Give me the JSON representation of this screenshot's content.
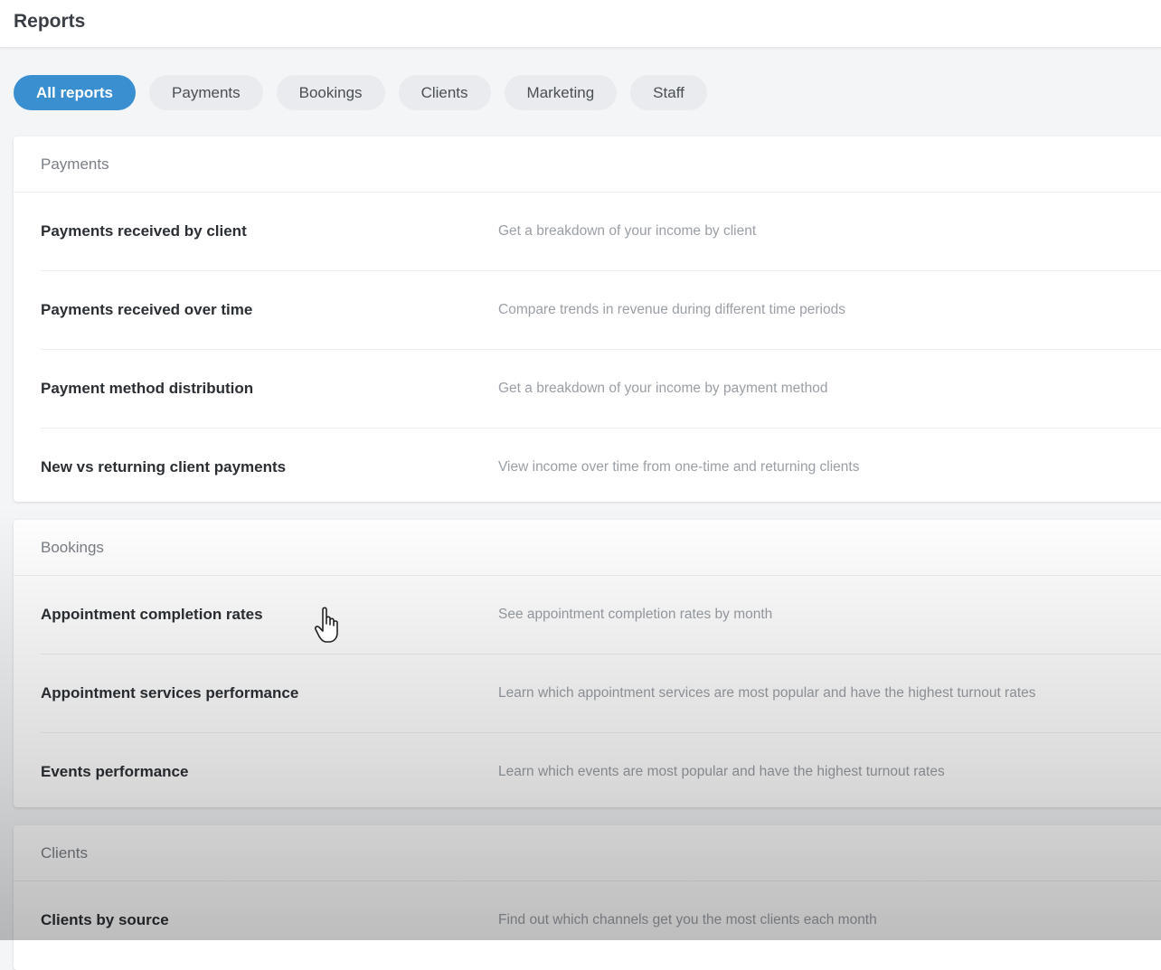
{
  "header": {
    "title": "Reports"
  },
  "tabs": [
    {
      "label": "All reports",
      "active": true
    },
    {
      "label": "Payments",
      "active": false
    },
    {
      "label": "Bookings",
      "active": false
    },
    {
      "label": "Clients",
      "active": false
    },
    {
      "label": "Marketing",
      "active": false
    },
    {
      "label": "Staff",
      "active": false
    }
  ],
  "sections": {
    "payments": {
      "title": "Payments",
      "rows": [
        {
          "title": "Payments received by client",
          "desc": "Get a breakdown of your income by client"
        },
        {
          "title": "Payments received over time",
          "desc": "Compare trends in revenue during different time periods"
        },
        {
          "title": "Payment method distribution",
          "desc": "Get a breakdown of your income by payment method"
        },
        {
          "title": "New vs returning client payments",
          "desc": "View income over time from one-time and returning clients"
        }
      ]
    },
    "bookings": {
      "title": "Bookings",
      "rows": [
        {
          "title": "Appointment completion rates",
          "desc": "See appointment completion rates by month"
        },
        {
          "title": "Appointment services performance",
          "desc": "Learn which appointment services are most popular and have the highest turnout rates"
        },
        {
          "title": "Events performance",
          "desc": "Learn which events are most popular and have the highest turnout rates"
        }
      ]
    },
    "clients": {
      "title": "Clients",
      "rows": [
        {
          "title": "Clients by source",
          "desc": "Find out which channels get you the most clients each month"
        }
      ]
    }
  },
  "colors": {
    "accent": "#3a8fd0",
    "tab_bg": "#e9ebee",
    "muted_text": "#9a9fa5"
  },
  "icons": {
    "cursor": "hand-pointer-icon"
  }
}
